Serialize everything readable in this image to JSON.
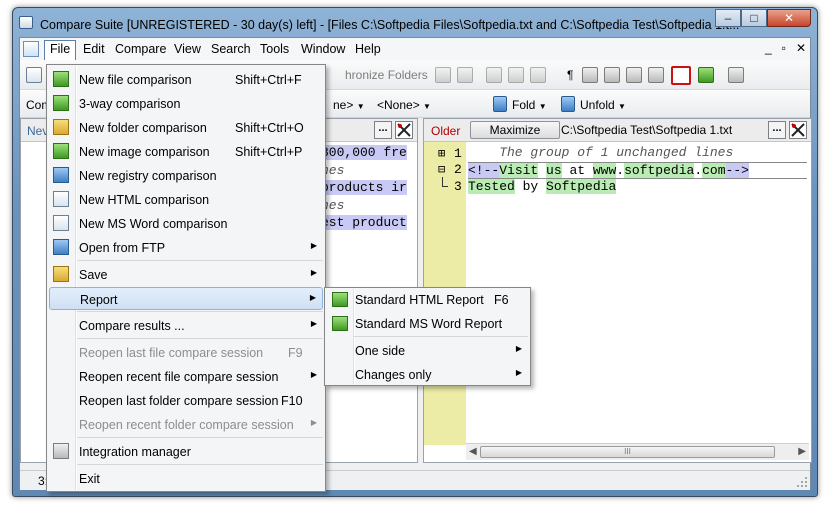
{
  "window": {
    "title": "Compare Suite [UNREGISTERED - 30 day(s) left] - [Files C:\\Softpedia Files\\Softpedia.txt and C:\\Softpedia Test\\Softpedia 1.t...",
    "min": "–",
    "max": "□",
    "close": "✕"
  },
  "menubar": {
    "items": [
      "File",
      "Edit",
      "Compare",
      "View",
      "Search",
      "Tools",
      "Window",
      "Help"
    ],
    "mdi": {
      "min": "_",
      "max": "▫",
      "close": "✕"
    }
  },
  "toolbar": {
    "sync_folders": "hronize Folders",
    "left_partial": "Com",
    "none1": "ne>",
    "none2": "<None>",
    "fold": "Fold",
    "unfold": "Unfold",
    "pilcrow": "¶"
  },
  "left_panel": {
    "tab_partial": "Nev",
    "code": [
      "800,000 fre",
      "nes",
      "products ir",
      "nes",
      "est product"
    ]
  },
  "right_panel": {
    "older_label": "Older",
    "maximize": "Maximize",
    "path": "C:\\Softpedia Test\\Softpedia 1.txt",
    "ellipsis": "...",
    "line_numbers": [
      "1",
      "2",
      "3"
    ],
    "group_text": "    The group of 1 unchanged lines",
    "line2": {
      "p1": "<!--",
      "p2": "Visit",
      "p3": " ",
      "p4": "us",
      "p5": " at ",
      "p6": "www",
      "p7": ".",
      "p8": "softpedia",
      "p9": ".",
      "p10": "com",
      "p11": "-->"
    },
    "line3": {
      "p1": "Tested",
      "p2": " by ",
      "p3": "Softpedia"
    },
    "scroll_thumb": "III"
  },
  "status": {
    "text": "3:"
  },
  "file_menu": {
    "items": [
      {
        "label": "New file comparison",
        "shortcut": "Shift+Ctrl+F"
      },
      {
        "label": "3-way comparison",
        "shortcut": ""
      },
      {
        "label": "New folder comparison",
        "shortcut": "Shift+Ctrl+O"
      },
      {
        "label": "New image comparison",
        "shortcut": "Shift+Ctrl+P"
      },
      {
        "label": "New registry comparison",
        "shortcut": ""
      },
      {
        "label": "New HTML comparison",
        "shortcut": ""
      },
      {
        "label": "New MS Word comparison",
        "shortcut": ""
      },
      {
        "label": "Open from FTP",
        "shortcut": ""
      },
      {
        "label": "Save",
        "shortcut": ""
      },
      {
        "label": "Report",
        "shortcut": ""
      },
      {
        "label": "Compare results ...",
        "shortcut": ""
      },
      {
        "label": "Reopen last file compare session",
        "shortcut": "F9"
      },
      {
        "label": "Reopen recent file compare session",
        "shortcut": ""
      },
      {
        "label": "Reopen last folder compare session",
        "shortcut": "F10"
      },
      {
        "label": "Reopen recent folder compare session",
        "shortcut": ""
      },
      {
        "label": "Integration manager",
        "shortcut": ""
      },
      {
        "label": "Exit",
        "shortcut": ""
      }
    ]
  },
  "report_menu": {
    "items": [
      {
        "label": "Standard HTML Report",
        "shortcut": "F6"
      },
      {
        "label": "Standard MS Word Report",
        "shortcut": ""
      },
      {
        "label": "One side",
        "shortcut": ""
      },
      {
        "label": "Changes only",
        "shortcut": ""
      }
    ]
  },
  "submenu_arrow": "▶"
}
